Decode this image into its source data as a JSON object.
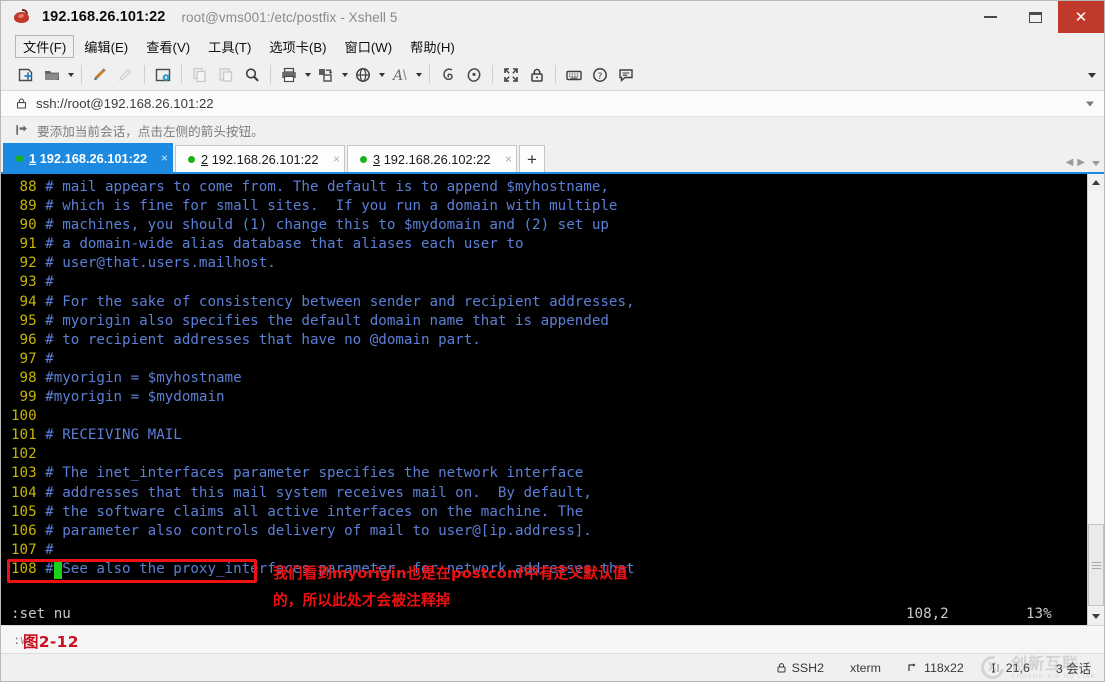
{
  "window": {
    "title_main": "192.168.26.101:22",
    "title_sub": "root@vms001:/etc/postfix - Xshell 5",
    "app_icon": "xshell-bean-icon",
    "minimize_label": "–",
    "maximize_label": "",
    "close_label": "✕"
  },
  "menubar": {
    "items": [
      {
        "label": "文件(F)",
        "name": "menu-file"
      },
      {
        "label": "编辑(E)",
        "name": "menu-edit"
      },
      {
        "label": "查看(V)",
        "name": "menu-view"
      },
      {
        "label": "工具(T)",
        "name": "menu-tools"
      },
      {
        "label": "选项卡(B)",
        "name": "menu-tabs"
      },
      {
        "label": "窗口(W)",
        "name": "menu-window"
      },
      {
        "label": "帮助(H)",
        "name": "menu-help"
      }
    ]
  },
  "toolbar": {
    "icons": [
      "new-session-icon",
      "open-folder-icon",
      "pencil-edit-icon",
      "pencil-dim-icon",
      "session-properties-icon",
      "copy-icon",
      "paste-icon",
      "find-icon",
      "print-icon",
      "transfer-icon",
      "globe-icon",
      "font-icon",
      "ssh-key-icon",
      "tunnel-icon",
      "fullscreen-icon",
      "lock-icon",
      "keyboard-icon",
      "help-icon",
      "chat-icon"
    ],
    "overflow_label": "toolbar-overflow"
  },
  "address": {
    "lock_icon": "lock-icon",
    "value": "ssh://root@192.168.26.101:22",
    "placeholder": "ssh://"
  },
  "hint": {
    "icon": "add-session-arrow-icon",
    "text": "要添加当前会话，点击左侧的箭头按钮。"
  },
  "tabs": {
    "items": [
      {
        "num": "1",
        "label": "192.168.26.101:22",
        "active": true,
        "status": "connected"
      },
      {
        "num": "2",
        "label": "192.168.26.101:22",
        "active": false,
        "status": "connected"
      },
      {
        "num": "3",
        "label": "192.168.26.102:22",
        "active": false,
        "status": "connected"
      }
    ],
    "close_label": "×",
    "add_label": "+",
    "nav_prev": "◀",
    "nav_next": "▶"
  },
  "terminal": {
    "lines": [
      {
        "num": "88",
        "text": "# mail appears to come from. The default is to append $myhostname,"
      },
      {
        "num": "89",
        "text": "# which is fine for small sites.  If you run a domain with multiple"
      },
      {
        "num": "90",
        "text": "# machines, you should (1) change this to $mydomain and (2) set up"
      },
      {
        "num": "91",
        "text": "# a domain-wide alias database that aliases each user to"
      },
      {
        "num": "92",
        "text": "# user@that.users.mailhost."
      },
      {
        "num": "93",
        "text": "#"
      },
      {
        "num": "94",
        "text": "# For the sake of consistency between sender and recipient addresses,"
      },
      {
        "num": "95",
        "text": "# myorigin also specifies the default domain name that is appended"
      },
      {
        "num": "96",
        "text": "# to recipient addresses that have no @domain part."
      },
      {
        "num": "97",
        "text": "#"
      },
      {
        "num": "98",
        "text": "#myorigin = $myhostname"
      },
      {
        "num": "99",
        "text": "#myorigin = $mydomain"
      },
      {
        "num": "100",
        "text": ""
      },
      {
        "num": "101",
        "text": "# RECEIVING MAIL"
      },
      {
        "num": "102",
        "text": ""
      },
      {
        "num": "103",
        "text": "# The inet_interfaces parameter specifies the network interface"
      },
      {
        "num": "104",
        "text": "# addresses that this mail system receives mail on.  By default,"
      },
      {
        "num": "105",
        "text": "# the software claims all active interfaces on the machine. The"
      },
      {
        "num": "106",
        "text": "# parameter also controls delivery of mail to user@[ip.address]."
      },
      {
        "num": "107",
        "text": "#"
      },
      {
        "num": "108",
        "text": "#",
        "cursor": true,
        "tail": "See also the proxy_interfaces parameter, for network addresses that"
      }
    ],
    "status": {
      "command": ":set nu",
      "position": "108,2",
      "percent": "13%"
    },
    "colors": {
      "background": "#000000",
      "line_number": "#c8b400",
      "comment": "#5c7fd6",
      "cursor": "#19d219"
    }
  },
  "annotation": {
    "highlight_color": "#ee1111",
    "text": "我们看到myorigin也是在postconf中有定义默认值\n的，所以此处才会被注释掉",
    "boxed_line": "#myorigin = $myhostname"
  },
  "cmdline": {
    "text": ":w",
    "figure_caption": "图2-12"
  },
  "statusbar": {
    "cells": [
      {
        "icon": "lock-icon",
        "label": "SSH2",
        "name": "status-protocol"
      },
      {
        "icon": "",
        "label": "xterm",
        "name": "status-terminal-type"
      },
      {
        "icon": "resize-icon",
        "label": "118x22",
        "name": "status-size"
      },
      {
        "icon": "cursor-icon",
        "label": "21,6",
        "name": "status-cursor"
      },
      {
        "icon": "",
        "label": "3 会话",
        "name": "status-sessions"
      }
    ]
  },
  "watermark": {
    "cn": "创新互联",
    "en": "CHUANG XIN HU LIAN"
  }
}
